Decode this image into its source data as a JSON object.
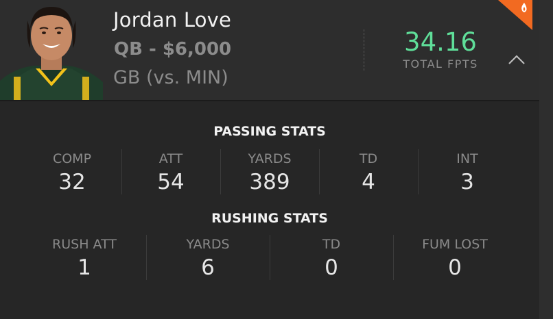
{
  "player": {
    "name": "Jordan Love",
    "position_salary": "QB - $6,000",
    "team_matchup": "GB (vs. MIN)",
    "fpts_value": "34.16",
    "fpts_label": "TOTAL FPTS"
  },
  "passing": {
    "title": "PASSING STATS",
    "stats": [
      {
        "label": "COMP",
        "value": "32"
      },
      {
        "label": "ATT",
        "value": "54"
      },
      {
        "label": "YARDS",
        "value": "389"
      },
      {
        "label": "TD",
        "value": "4"
      },
      {
        "label": "INT",
        "value": "3"
      }
    ]
  },
  "rushing": {
    "title": "RUSHING STATS",
    "stats": [
      {
        "label": "RUSH ATT",
        "value": "1"
      },
      {
        "label": "YARDS",
        "value": "6"
      },
      {
        "label": "TD",
        "value": "0"
      },
      {
        "label": "FUM LOST",
        "value": "0"
      }
    ]
  },
  "icons": {
    "collapse": "chevron-up-icon",
    "hot": "fire-icon"
  },
  "colors": {
    "fpts": "#5fde99",
    "hot_badge": "#f26a21"
  }
}
